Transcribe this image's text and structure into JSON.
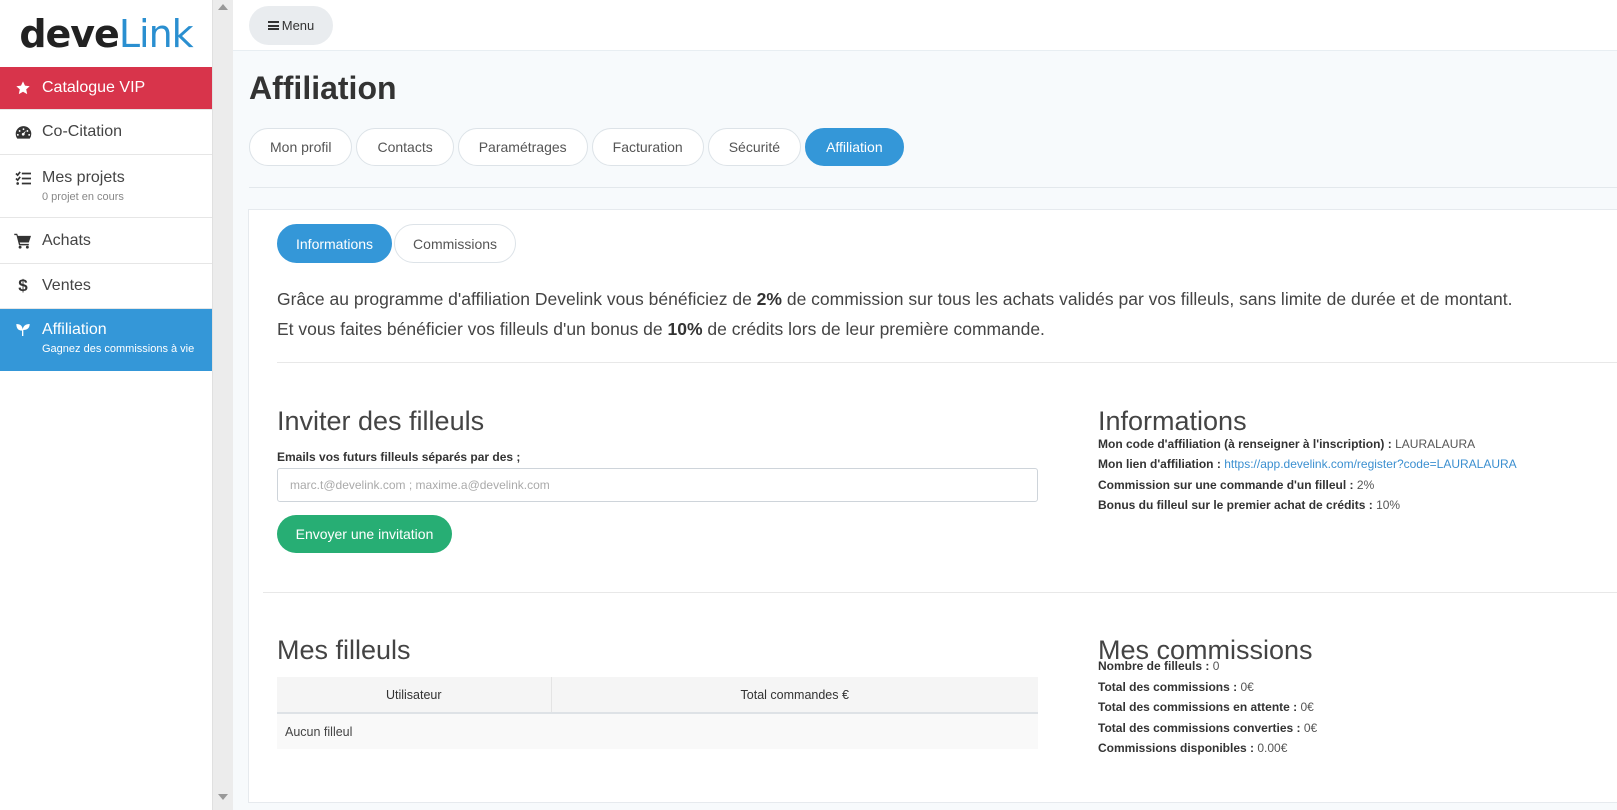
{
  "brand": {
    "logo_part1": "deve",
    "logo_part2": "Link"
  },
  "sidebar": {
    "items": [
      {
        "label": "Catalogue VIP",
        "icon": "star-icon"
      },
      {
        "label": "Co-Citation",
        "icon": "gauge-icon"
      },
      {
        "label": "Mes projets",
        "sub": "0 projet en cours",
        "icon": "checklist-icon"
      },
      {
        "label": "Achats",
        "icon": "cart-icon"
      },
      {
        "label": "Ventes",
        "icon": "dollar-icon"
      },
      {
        "label": "Affiliation",
        "sub": "Gagnez des commissions à vie",
        "icon": "seedling-icon"
      }
    ]
  },
  "topbar": {
    "menu_label": "Menu"
  },
  "page": {
    "title": "Affiliation"
  },
  "tabs": [
    "Mon profil",
    "Contacts",
    "Paramétrages",
    "Facturation",
    "Sécurité",
    "Affiliation"
  ],
  "subtabs": [
    "Informations",
    "Commissions"
  ],
  "intro": {
    "line1_a": "Grâce au programme d'affiliation Develink vous bénéficiez de ",
    "line1_b": "2%",
    "line1_c": " de commission sur tous les achats validés par vos filleuls, sans limite de durée et de montant.",
    "line2_a": "Et vous faites bénéficier vos filleuls d'un bonus de ",
    "line2_b": "10%",
    "line2_c": " de crédits lors de leur première commande."
  },
  "invite": {
    "title": "Inviter des filleuls",
    "label": "Emails vos futurs filleuls séparés par des ;",
    "placeholder": "marc.t@develink.com ; maxime.a@develink.com",
    "button": "Envoyer une invitation"
  },
  "informations": {
    "title": "Informations",
    "code_label": "Mon code d'affiliation (à renseigner à l'inscription) :",
    "code_value": "LAURALAURA",
    "link_label": "Mon lien d'affiliation :",
    "link_value": "https://app.develink.com/register?code=LAURALAURA",
    "commission_label": "Commission sur une commande d'un filleul :",
    "commission_value": "2%",
    "bonus_label": "Bonus du filleul sur le premier achat de crédits :",
    "bonus_value": "10%"
  },
  "filleuls": {
    "title": "Mes filleuls",
    "columns": [
      "Utilisateur",
      "Total commandes €"
    ],
    "empty": "Aucun filleul"
  },
  "commissions": {
    "title": "Mes commissions",
    "rows": [
      {
        "label": "Nombre de filleuls :",
        "value": "0"
      },
      {
        "label": "Total des commissions :",
        "value": "0€"
      },
      {
        "label": "Total des commissions en attente :",
        "value": "0€"
      },
      {
        "label": "Total des commissions converties :",
        "value": "0€"
      },
      {
        "label": "Commissions disponibles :",
        "value": "0.00€"
      }
    ]
  },
  "colors": {
    "vip": "#d8344b",
    "accent": "#3497d8",
    "success": "#27ae74",
    "link": "#3b8fd0"
  }
}
